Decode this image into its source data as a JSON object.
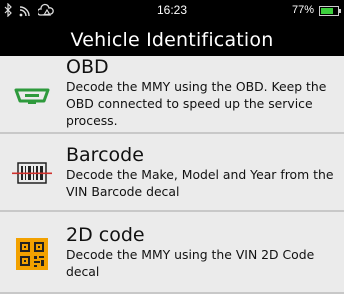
{
  "status_bar": {
    "time": "16:23",
    "battery_percent": "77%",
    "battery_level": 0.77,
    "icons": [
      "bluetooth-icon",
      "wifi-icon",
      "cloud-icon"
    ]
  },
  "header": {
    "title": "Vehicle Identification"
  },
  "items": [
    {
      "name": "OBD",
      "description": "Decode the MMY using the OBD. Keep the OBD connected to speed up the service process.",
      "icon": "obd-connector-icon"
    },
    {
      "name": "Barcode",
      "description": "Decode the Make, Model and Year from the VIN Barcode decal",
      "icon": "barcode-icon"
    },
    {
      "name": "2D code",
      "description": "Decode the MMY using the VIN 2D Code decal",
      "icon": "qr-code-icon"
    }
  ],
  "colors": {
    "obd_icon": "#2e9a3c",
    "qr_icon_bg": "#f2a100",
    "barcode_line": "#d0312d",
    "battery_fill": "#3ccf3c"
  }
}
